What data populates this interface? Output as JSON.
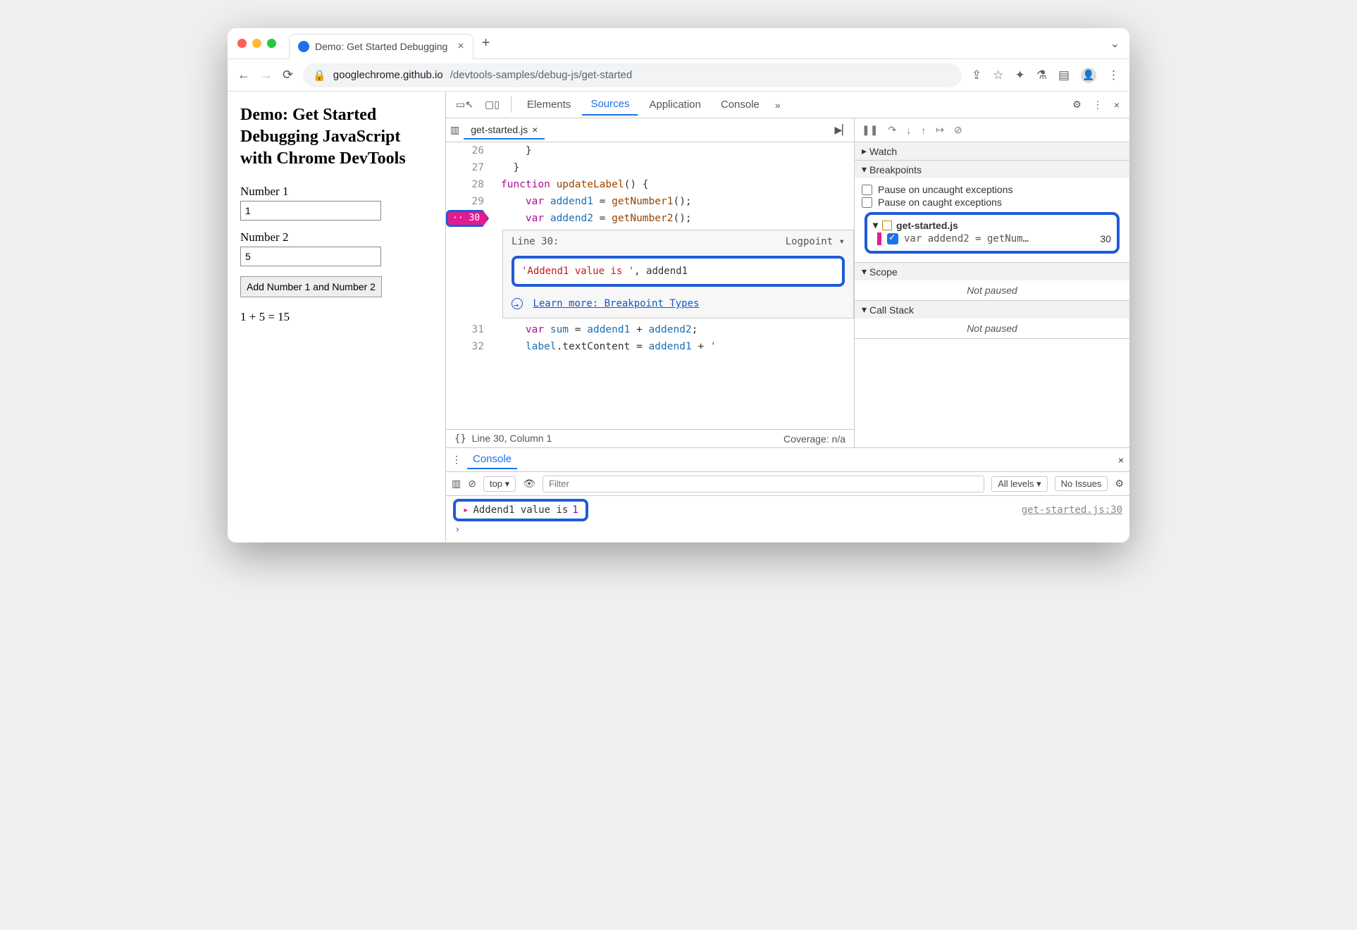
{
  "browser": {
    "tab_title": "Demo: Get Started Debugging",
    "url_domain": "googlechrome.github.io",
    "url_path": "/devtools-samples/debug-js/get-started"
  },
  "page": {
    "heading": "Demo: Get Started Debugging JavaScript with Chrome DevTools",
    "label1": "Number 1",
    "value1": "1",
    "label2": "Number 2",
    "value2": "5",
    "button": "Add Number 1 and Number 2",
    "result": "1 + 5 = 15"
  },
  "devtools": {
    "tabs": {
      "elements": "Elements",
      "sources": "Sources",
      "application": "Application",
      "console": "Console"
    },
    "file_tab": "get-started.js",
    "code": {
      "l26": "    }",
      "l27": "  }",
      "l28_a": "function",
      "l28_b": " updateLabel",
      "l28_c": "() {",
      "l29_a": "    var",
      "l29_b": " addend1",
      "l29_c": " = ",
      "l29_d": "getNumber1",
      "l29_e": "();",
      "l30_a": "    var",
      "l30_b": " addend2",
      "l30_c": " = ",
      "l30_d": "getNumber2",
      "l30_e": "();",
      "l31_a": "    var",
      "l31_b": " sum",
      "l31_c": " = ",
      "l31_d": "addend1",
      "l31_e": " + ",
      "l31_f": "addend2",
      "l31_g": ";",
      "l32_a": "    label",
      "l32_b": ".textContent = ",
      "l32_c": "addend1",
      "l32_d": " + ",
      "l32_e": "' "
    },
    "gutters": {
      "g26": "26",
      "g27": "27",
      "g28": "28",
      "g29": "29",
      "g30": "30",
      "g31": "31",
      "g32": "32"
    },
    "logpoint": {
      "marker": "·· 30",
      "header_left": "Line 30:",
      "header_right": "Logpoint",
      "expr_a": "'Addend1 value is '",
      "expr_b": ", addend1",
      "learn": "Learn more: Breakpoint Types"
    },
    "status": {
      "left": "Line 30, Column 1",
      "right": "Coverage: n/a",
      "braces": "{}"
    },
    "right": {
      "watch": "Watch",
      "breakpoints": "Breakpoints",
      "pause_uncaught": "Pause on uncaught exceptions",
      "pause_caught": "Pause on caught exceptions",
      "bp_file": "get-started.js",
      "bp_line_text": "var addend2 = getNum…",
      "bp_line_num": "30",
      "scope": "Scope",
      "not_paused": "Not paused",
      "call_stack": "Call Stack",
      "not_paused2": "Not paused"
    },
    "console": {
      "tab": "Console",
      "context": "top",
      "filter_placeholder": "Filter",
      "levels": "All levels",
      "issues": "No Issues",
      "log_text": "Addend1 value is ",
      "log_val": "1",
      "log_src": "get-started.js:30"
    }
  }
}
